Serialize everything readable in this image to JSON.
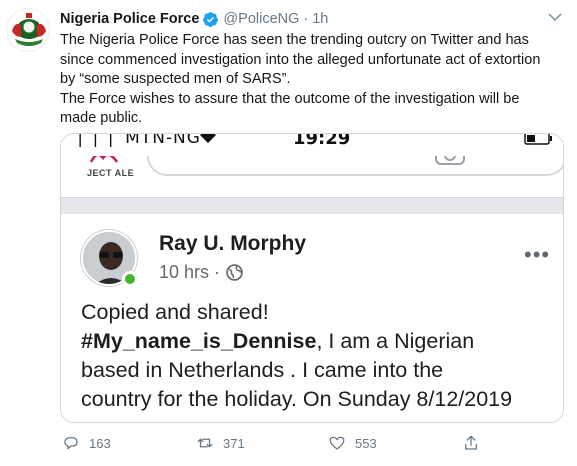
{
  "tweet": {
    "display_name": "Nigeria Police Force",
    "handle": "@PoliceNG",
    "separator": "·",
    "time": "1h",
    "lines": [
      "The Nigeria Police Force has seen the trending outcry on Twitter and has",
      "since commenced investigation into the alleged unfortunate act of extortion",
      "by “some suspected men of SARS”.",
      "The Force wishes to assure that the outcome of the investigation will be",
      "made public."
    ]
  },
  "media": {
    "status_carrier": "❘❘❘ MTN-NG",
    "status_time": "19:29",
    "alert_label": "JECT ALE",
    "fb_post": {
      "author": "Ray U. Morphy",
      "time": "10 hrs",
      "meta_separator": "·",
      "more": "•••",
      "body_line1": "Copied and shared!",
      "hashtag": "#My_name_is_Dennise",
      "body_line2_rest": ", I am a Nigerian",
      "body_line3": "based in Netherlands . I came into the",
      "body_line4": "country for the holiday. On Sunday 8/12/2019"
    }
  },
  "actions": {
    "reply_count": "163",
    "retweet_count": "371",
    "like_count": "553"
  },
  "colors": {
    "verified_blue": "#1da1f2",
    "secondary_text": "#657786",
    "online_green": "#42b72a"
  },
  "icons": [
    "verified-badge-icon",
    "chevron-down-icon",
    "reply-icon",
    "retweet-icon",
    "like-icon",
    "share-icon",
    "globe-icon",
    "wifi-icon",
    "battery-icon",
    "camera-icon"
  ]
}
